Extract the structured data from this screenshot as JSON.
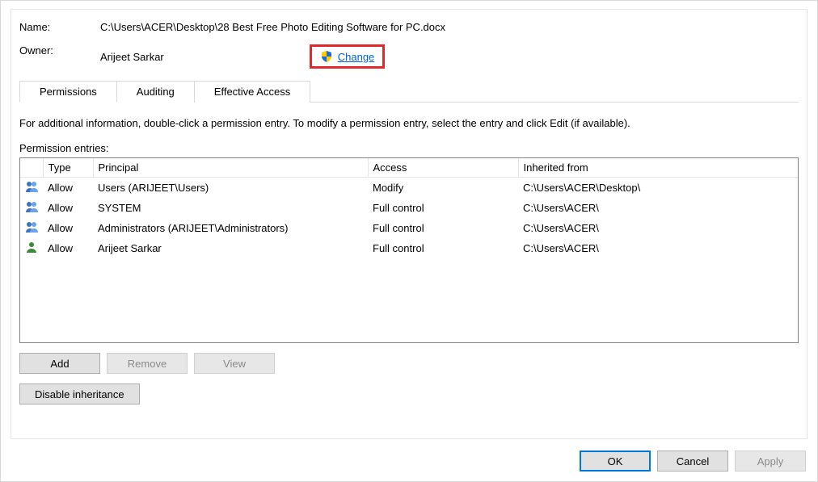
{
  "labels": {
    "name": "Name:",
    "owner": "Owner:"
  },
  "values": {
    "name": "C:\\Users\\ACER\\Desktop\\28 Best Free Photo Editing Software for PC.docx",
    "owner": "Arijeet Sarkar"
  },
  "change_link": "Change",
  "tabs": {
    "permissions": "Permissions",
    "auditing": "Auditing",
    "effective": "Effective Access"
  },
  "instruction": "For additional information, double-click a permission entry. To modify a permission entry, select the entry and click Edit (if available).",
  "pe_label": "Permission entries:",
  "columns": {
    "type": "Type",
    "principal": "Principal",
    "access": "Access",
    "inherited": "Inherited from"
  },
  "entries": [
    {
      "icon": "group",
      "type": "Allow",
      "principal": "Users (ARIJEET\\Users)",
      "access": "Modify",
      "inherited": "C:\\Users\\ACER\\Desktop\\"
    },
    {
      "icon": "group",
      "type": "Allow",
      "principal": "SYSTEM",
      "access": "Full control",
      "inherited": "C:\\Users\\ACER\\"
    },
    {
      "icon": "group",
      "type": "Allow",
      "principal": "Administrators (ARIJEET\\Administrators)",
      "access": "Full control",
      "inherited": "C:\\Users\\ACER\\"
    },
    {
      "icon": "user",
      "type": "Allow",
      "principal": "Arijeet Sarkar",
      "access": "Full control",
      "inherited": "C:\\Users\\ACER\\"
    }
  ],
  "buttons": {
    "add": "Add",
    "remove": "Remove",
    "view": "View",
    "disable_inh": "Disable inheritance",
    "ok": "OK",
    "cancel": "Cancel",
    "apply": "Apply"
  }
}
